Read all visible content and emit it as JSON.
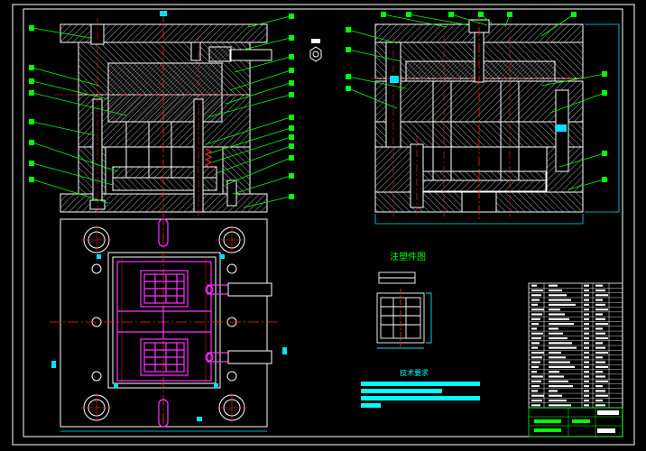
{
  "drawing": {
    "inset_title": "注塑件图",
    "tech_req_title": "技术要求",
    "colors": {
      "background": "#000000",
      "frame": "#ffffff",
      "hatch": "#ffffff",
      "center_line": "#ff2020",
      "leader": "#00ff00",
      "dimension": "#00e0ff",
      "part": "#ff33ff",
      "note_bar": "#00ffff",
      "title_block": "#00ff00"
    }
  }
}
